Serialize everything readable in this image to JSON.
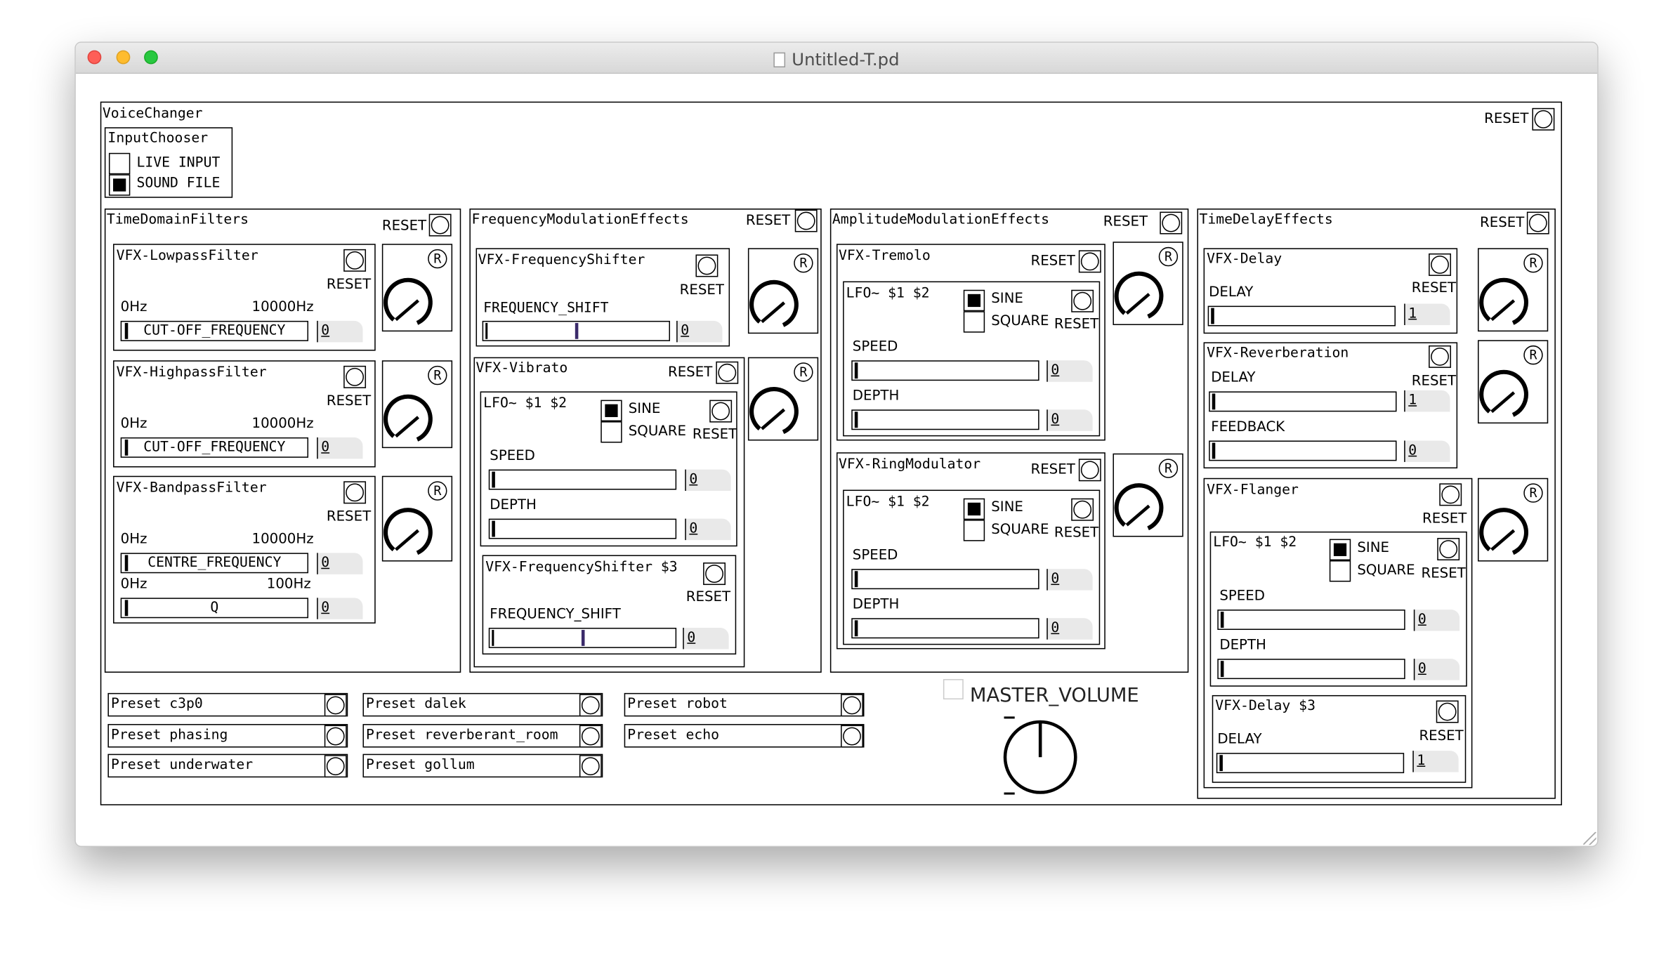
{
  "window": {
    "title": "Untitled-T.pd",
    "close_color": "#fe5f57",
    "minimize_color": "#febc2e",
    "zoom_color": "#28c840"
  },
  "voice_changer": {
    "label": "VoiceChanger",
    "reset_label": "RESET"
  },
  "input_chooser": {
    "label": "InputChooser",
    "live_input": "LIVE INPUT",
    "sound_file": "SOUND FILE",
    "selected": "SOUND FILE"
  },
  "time_domain": {
    "label": "TimeDomainFilters",
    "reset_label": "RESET",
    "lowpass": {
      "label": "VFX-LowpassFilter",
      "reset": "RESET",
      "min": "0Hz",
      "max": "10000Hz",
      "slider": "CUT-OFF_FREQUENCY",
      "value": "0"
    },
    "highpass": {
      "label": "VFX-HighpassFilter",
      "reset": "RESET",
      "min": "0Hz",
      "max": "10000Hz",
      "slider": "CUT-OFF_FREQUENCY",
      "value": "0"
    },
    "bandpass": {
      "label": "VFX-BandpassFilter",
      "reset": "RESET",
      "min": "0Hz",
      "max": "10000Hz",
      "slider": "CENTRE_FREQUENCY",
      "value": "0",
      "q_min": "0Hz",
      "q_max": "100Hz",
      "q_slider": "Q",
      "q_value": "0"
    }
  },
  "freq_mod": {
    "label": "FrequencyModulationEffects",
    "reset_label": "RESET",
    "shifter": {
      "label": "VFX-FrequencyShifter",
      "reset": "RESET",
      "slider_label": "FREQUENCY_SHIFT",
      "value": "0",
      "position": 0.5
    },
    "vibrato": {
      "label": "VFX-Vibrato",
      "reset": "RESET",
      "lfo": "LFO~ $1 $2",
      "sine": "SINE",
      "square": "SQUARE",
      "lfo_reset": "RESET",
      "speed": "SPEED",
      "speed_value": "0",
      "depth": "DEPTH",
      "depth_value": "0",
      "shifter": {
        "label": "VFX-FrequencyShifter $3",
        "reset": "RESET",
        "slider_label": "FREQUENCY_SHIFT",
        "value": "0",
        "position": 0.5
      }
    }
  },
  "amp_mod": {
    "label": "AmplitudeModulationEffects",
    "reset_label": "RESET",
    "tremolo": {
      "label": "VFX-Tremolo",
      "reset": "RESET",
      "lfo": "LFO~ $1 $2",
      "sine": "SINE",
      "square": "SQUARE",
      "lfo_reset": "RESET",
      "speed": "SPEED",
      "speed_value": "0",
      "depth": "DEPTH",
      "depth_value": "0"
    },
    "ring": {
      "label": "VFX-RingModulator",
      "reset": "RESET",
      "lfo": "LFO~ $1 $2",
      "sine": "SINE",
      "square": "SQUARE",
      "lfo_reset": "RESET",
      "speed": "SPEED",
      "speed_value": "0",
      "depth": "DEPTH",
      "depth_value": "0"
    }
  },
  "time_delay": {
    "label": "TimeDelayEffects",
    "reset_label": "RESET",
    "delay": {
      "label": "VFX-Delay",
      "reset": "RESET",
      "delay": "DELAY",
      "delay_value": "1"
    },
    "reverb": {
      "label": "VFX-Reverberation",
      "reset": "RESET",
      "delay": "DELAY",
      "delay_value": "1",
      "feedback": "FEEDBACK",
      "feedback_value": "0"
    },
    "flanger": {
      "label": "VFX-Flanger",
      "reset": "RESET",
      "lfo": "LFO~ $1 $2",
      "sine": "SINE",
      "square": "SQUARE",
      "lfo_reset": "RESET",
      "speed": "SPEED",
      "speed_value": "0",
      "depth": "DEPTH",
      "depth_value": "0",
      "delay": {
        "label": "VFX-Delay $3",
        "reset": "RESET",
        "delay": "DELAY",
        "delay_value": "1"
      }
    }
  },
  "presets": [
    [
      "Preset c3p0",
      "Preset phasing",
      "Preset underwater"
    ],
    [
      "Preset dalek",
      "Preset reverberant_room",
      "Preset gollum"
    ],
    [
      "Preset robot",
      "Preset echo"
    ]
  ],
  "master": {
    "label": "MASTER_VOLUME"
  },
  "knob_label": "R"
}
